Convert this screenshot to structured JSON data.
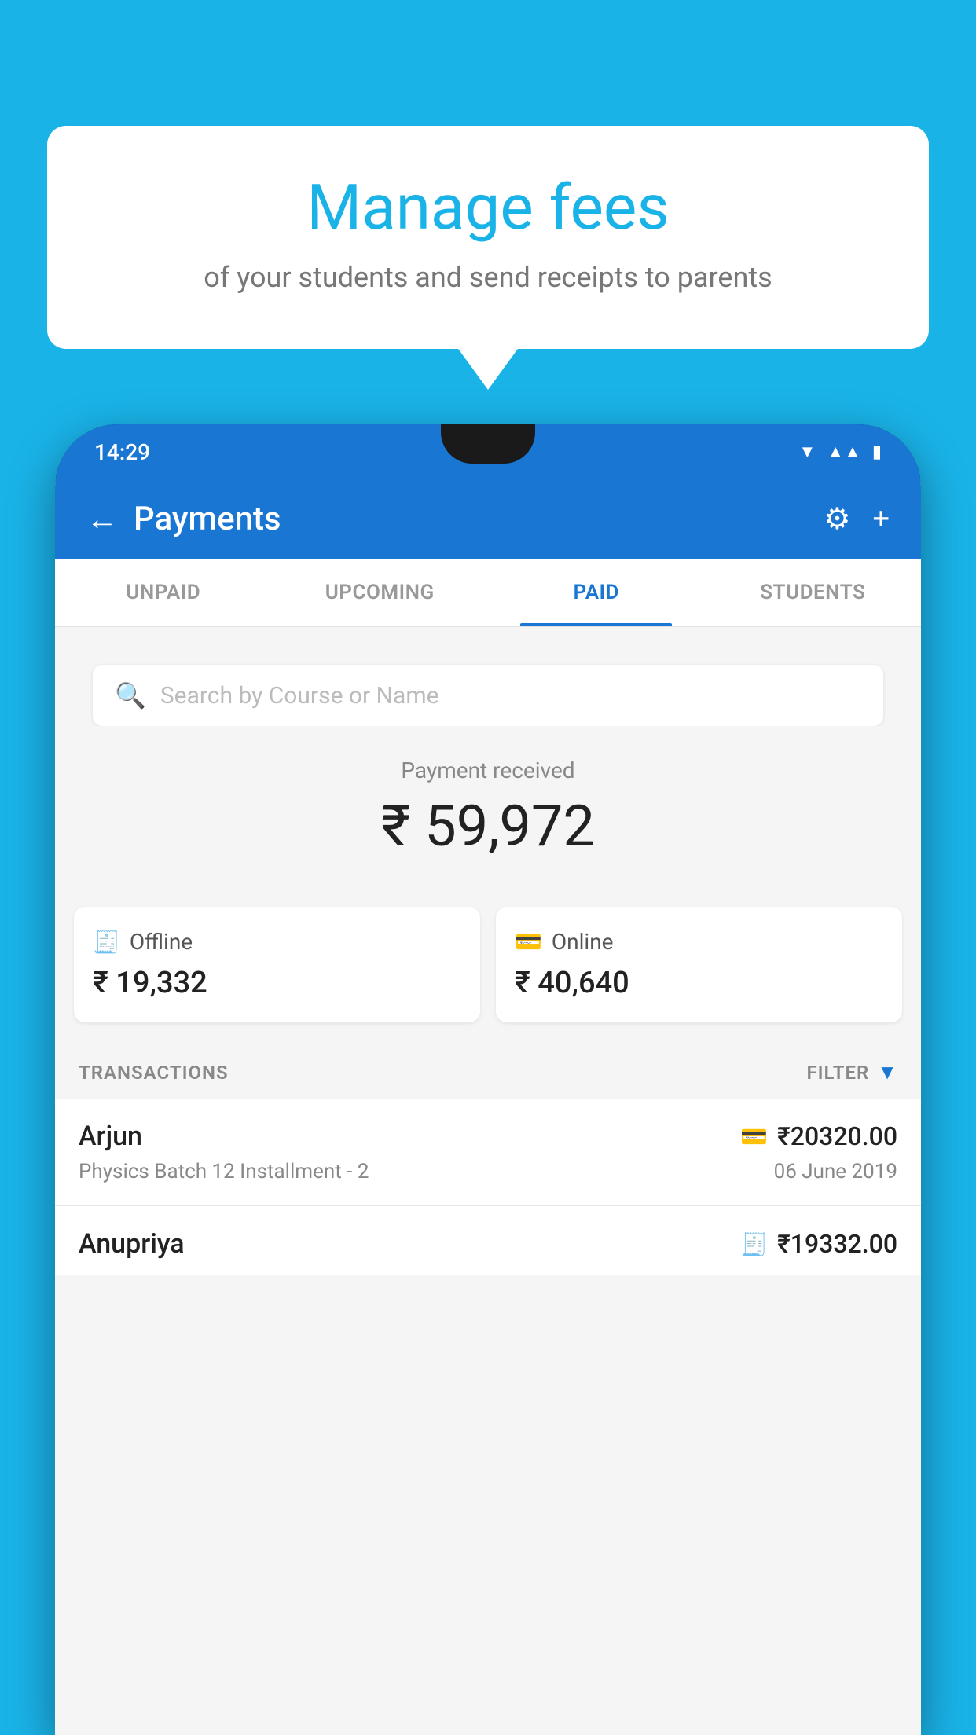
{
  "background_color": "#1ab3e8",
  "speech_bubble": {
    "title": "Manage fees",
    "subtitle": "of your students and send receipts to parents"
  },
  "status_bar": {
    "time": "14:29",
    "icons": [
      "wifi",
      "signal",
      "battery"
    ]
  },
  "app_header": {
    "title": "Payments",
    "back_label": "←",
    "settings_label": "⚙",
    "add_label": "+"
  },
  "tabs": [
    {
      "label": "UNPAID",
      "active": false
    },
    {
      "label": "UPCOMING",
      "active": false
    },
    {
      "label": "PAID",
      "active": true
    },
    {
      "label": "STUDENTS",
      "active": false
    }
  ],
  "search": {
    "placeholder": "Search by Course or Name"
  },
  "payment_summary": {
    "label": "Payment received",
    "amount": "₹ 59,972"
  },
  "payment_cards": [
    {
      "type": "Offline",
      "amount": "₹ 19,332",
      "icon": "💳"
    },
    {
      "type": "Online",
      "amount": "₹ 40,640",
      "icon": "🏧"
    }
  ],
  "transactions_header": {
    "label": "TRANSACTIONS",
    "filter_label": "FILTER"
  },
  "transactions": [
    {
      "name": "Arjun",
      "course": "Physics Batch 12 Installment - 2",
      "amount": "₹20320.00",
      "date": "06 June 2019",
      "type": "online"
    },
    {
      "name": "Anupriya",
      "course": "",
      "amount": "₹19332.00",
      "date": "",
      "type": "offline"
    }
  ]
}
